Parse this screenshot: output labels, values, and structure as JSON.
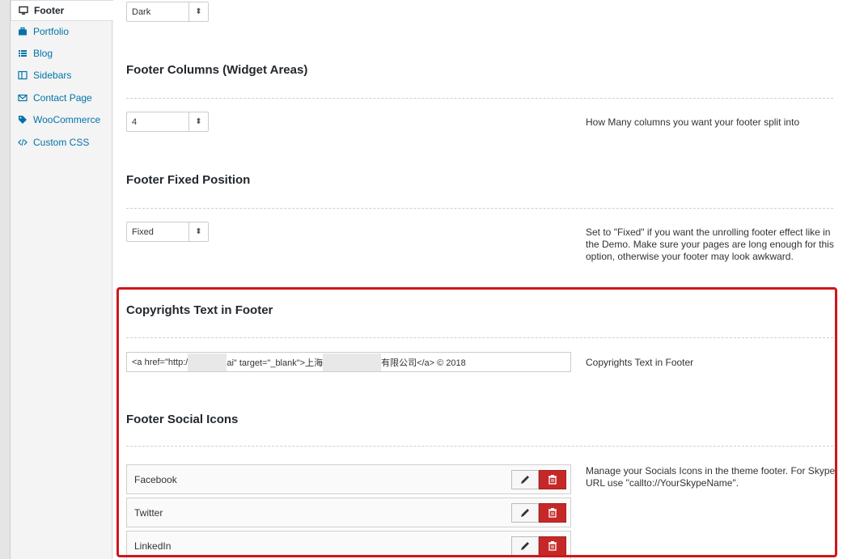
{
  "sidebar": {
    "items": [
      {
        "label": "Footer",
        "icon": "monitor-icon"
      },
      {
        "label": "Portfolio",
        "icon": "briefcase-icon"
      },
      {
        "label": "Blog",
        "icon": "list-icon"
      },
      {
        "label": "Sidebars",
        "icon": "columns-icon"
      },
      {
        "label": "Contact Page",
        "icon": "envelope-icon"
      },
      {
        "label": "WooCommerce",
        "icon": "tag-icon"
      },
      {
        "label": "Custom CSS",
        "icon": "code-icon"
      }
    ]
  },
  "footer_skin": {
    "value": "Dark"
  },
  "footer_columns": {
    "title": "Footer Columns (Widget Areas)",
    "value": "4",
    "desc": "How Many columns you want your footer split into"
  },
  "footer_fixed": {
    "title": "Footer Fixed Position",
    "value": "Fixed",
    "desc": "Set to \"Fixed\" if you want the unrolling footer effect like in the Demo. Make sure your pages are long enough for this option, otherwise your footer may look awkward."
  },
  "copyrights": {
    "title": "Copyrights Text in Footer",
    "value_part1": "<a href=\"http:/",
    "value_part2": "ai\" target=\"_blank\">上海",
    "value_part3": "有限公司</a> © 2018",
    "desc": "Copyrights Text in Footer"
  },
  "social_icons": {
    "title": "Footer Social Icons",
    "desc": "Manage your Socials Icons in the theme footer. For Skype URL use \"callto://YourSkypeName\".",
    "items": [
      {
        "name": "Facebook"
      },
      {
        "name": "Twitter"
      },
      {
        "name": "LinkedIn"
      }
    ]
  },
  "colors": {
    "highlight": "#d0161b",
    "delete_button": "#c62828",
    "link": "#0073aa"
  }
}
